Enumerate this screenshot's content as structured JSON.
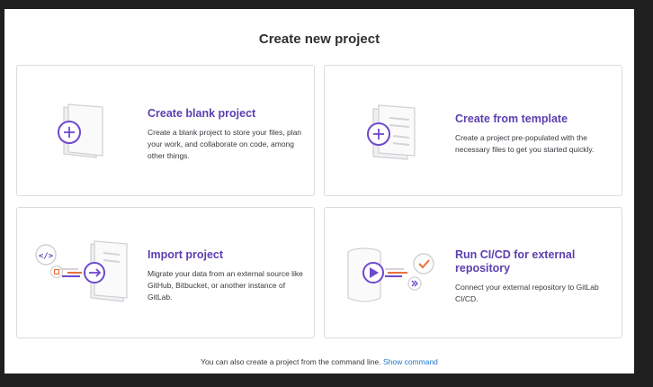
{
  "page": {
    "title": "Create new project"
  },
  "cards": [
    {
      "title": "Create blank project",
      "description": "Create a blank project to store your files, plan your work, and collaborate on code, among other things."
    },
    {
      "title": "Create from template",
      "description": "Create a project pre-populated with the necessary files to get you started quickly."
    },
    {
      "title": "Import project",
      "description": "Migrate your data from an external source like GitHub, Bitbucket, or another instance of GitLab."
    },
    {
      "title": "Run CI/CD for external repository",
      "description": "Connect your external repository to GitLab CI/CD."
    }
  ],
  "footer": {
    "text": "You can also create a project from the command line.",
    "link": "Show command"
  },
  "colors": {
    "accent": "#5b3fb0",
    "link": "#1f75cb",
    "orange": "#e9713a",
    "red": "#e24329"
  },
  "icons": {
    "blank": "plus-circle-icon",
    "template": "template-plus-icon",
    "import": "import-arrow-icon",
    "cicd": "play-pipeline-icon"
  }
}
